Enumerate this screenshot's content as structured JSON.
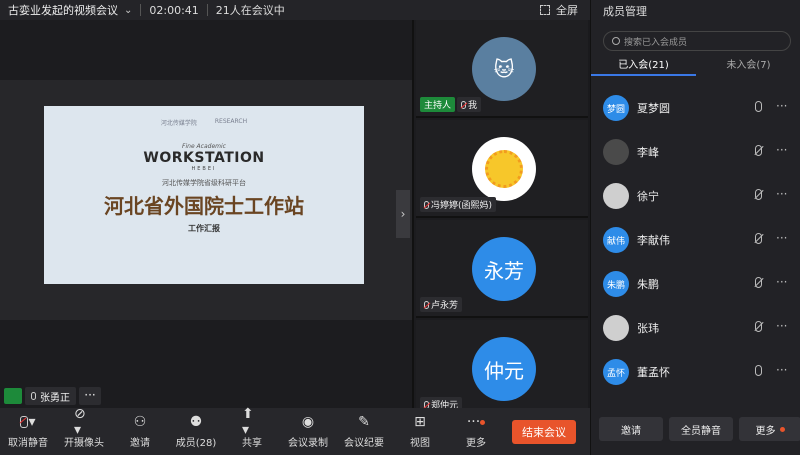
{
  "topbar": {
    "title": "古娈业发起的视频会议",
    "timer": "02:00:41",
    "count": "21人在会议中",
    "fullscreen": "全屏"
  },
  "slide": {
    "logo_left": "河北传媒学院",
    "logo_right": "RESEARCH",
    "ws_sub": "Fine Academic",
    "ws": "WORKSTATION",
    "ws_small": "HEBEI",
    "platform": "河北传媒学院省级科研平台",
    "main_title": "河北省外国院士工作站",
    "report": "工作汇报"
  },
  "speaker": {
    "name": "张勇正"
  },
  "videos": [
    {
      "host_tag": "主持人",
      "name": "我",
      "avatar_type": "cat-photo"
    },
    {
      "name": "冯婷婷(函熙妈)",
      "avatar_type": "sun-drawing"
    },
    {
      "name": "卢永芳",
      "avatar_text": "永芳"
    },
    {
      "name": "郑仲元",
      "avatar_text": "仲元"
    }
  ],
  "toolbar": {
    "mute": "取消静音",
    "camera": "开摄像头",
    "invite": "邀请",
    "members": "成员(28)",
    "share": "共享",
    "record": "会议录制",
    "minutes": "会议纪要",
    "view": "视图",
    "more": "更多",
    "end": "结束会议"
  },
  "panel": {
    "title": "成员管理",
    "search_placeholder": "搜索已入会成员",
    "tab_joined": "已入会(21)",
    "tab_not_joined": "未入会(7)",
    "members": [
      {
        "name": "夏梦圆",
        "avatar_text": "梦圆",
        "avatar_type": "text",
        "mic": "on"
      },
      {
        "name": "李峰",
        "avatar_text": "",
        "avatar_type": "photo-dark",
        "mic": "off"
      },
      {
        "name": "徐宁",
        "avatar_text": "",
        "avatar_type": "photo",
        "mic": "off"
      },
      {
        "name": "李献伟",
        "avatar_text": "献伟",
        "avatar_type": "text",
        "mic": "off"
      },
      {
        "name": "朱鹏",
        "avatar_text": "朱鹏",
        "avatar_type": "text",
        "mic": "off"
      },
      {
        "name": "张玮",
        "avatar_text": "",
        "avatar_type": "photo",
        "mic": "off"
      },
      {
        "name": "董孟怀",
        "avatar_text": "孟怀",
        "avatar_type": "text",
        "mic": "on"
      }
    ],
    "btn_invite": "邀请",
    "btn_mute_all": "全员静音",
    "btn_more": "更多"
  },
  "colors": {
    "accent": "#3a78e6",
    "end": "#e8542b",
    "host": "#1d8a3a",
    "avatar": "#2e8ce8"
  }
}
